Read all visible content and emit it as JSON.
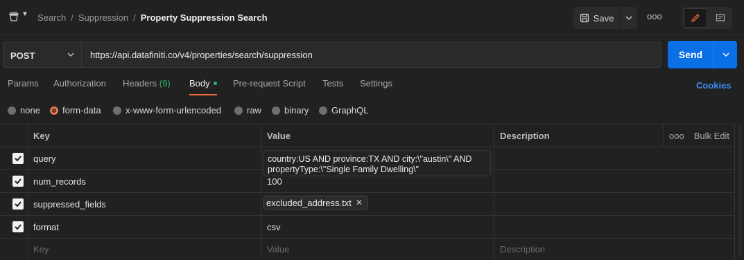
{
  "breadcrumb": {
    "items": [
      "Search",
      "Suppression"
    ],
    "current": "Property Suppression Search"
  },
  "toolbar": {
    "save_label": "Save",
    "more_label": "ooo"
  },
  "request": {
    "method": "POST",
    "url": "https://api.datafiniti.co/v4/properties/search/suppression",
    "send_label": "Send"
  },
  "tabs": {
    "params": "Params",
    "authorization": "Authorization",
    "headers": "Headers",
    "headers_count": "(9)",
    "body": "Body",
    "prerequest": "Pre-request Script",
    "tests": "Tests",
    "settings": "Settings",
    "cookies": "Cookies"
  },
  "body_types": {
    "selected": "form-data",
    "options": [
      "none",
      "form-data",
      "x-www-form-urlencoded",
      "raw",
      "binary",
      "GraphQL"
    ]
  },
  "table": {
    "headers": {
      "key": "Key",
      "value": "Value",
      "description": "Description",
      "bulk_edit": "Bulk Edit",
      "more": "ooo"
    },
    "rows": [
      {
        "key": "query",
        "value_line1": "country:US AND province:TX AND city:\\\"austin\\\" AND",
        "value_line2": "propertyType:\\\"Single Family Dwelling\\\""
      },
      {
        "key": "num_records",
        "value": "100"
      },
      {
        "key": "suppressed_fields",
        "file": "excluded_address.txt"
      },
      {
        "key": "format",
        "value": "csv"
      }
    ],
    "placeholders": {
      "key": "Key",
      "value": "Value",
      "description": "Description"
    }
  },
  "colors": {
    "accent": "#f26b3a",
    "send": "#0b6fe6",
    "green": "#2fb36f",
    "link": "#3b8df0"
  }
}
